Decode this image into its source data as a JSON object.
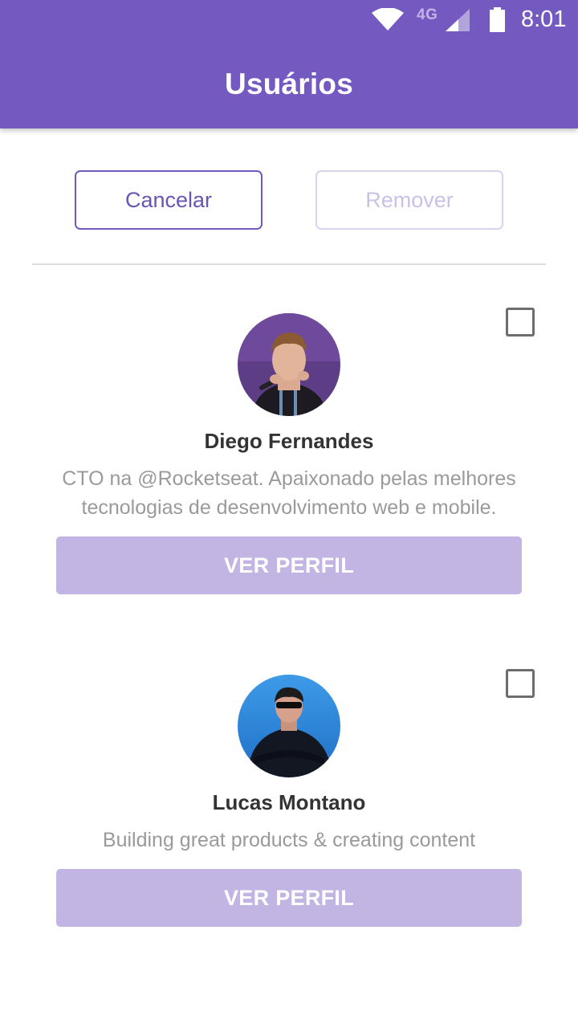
{
  "status_bar": {
    "network": "4G",
    "time": "8:01",
    "icons": [
      "wifi-icon",
      "signal-icon",
      "battery-icon"
    ]
  },
  "header": {
    "title": "Usuários",
    "background_color": "#7459c1"
  },
  "actions": {
    "cancel_label": "Cancelar",
    "remove_label": "Remover"
  },
  "users": [
    {
      "name": "Diego Fernandes",
      "bio": "CTO na @Rocketseat. Apaixonado pelas melhores tecnologias de desenvolvimento web e mobile.",
      "button_label": "VER PERFIL",
      "selected": false
    },
    {
      "name": "Lucas Montano",
      "bio": "Building great products & creating content",
      "button_label": "VER PERFIL",
      "selected": false
    }
  ],
  "colors": {
    "accent": "#7459c1",
    "button_disabled": "#c2b5e4",
    "muted_text": "#9a9a9a",
    "name_text": "#333333"
  }
}
